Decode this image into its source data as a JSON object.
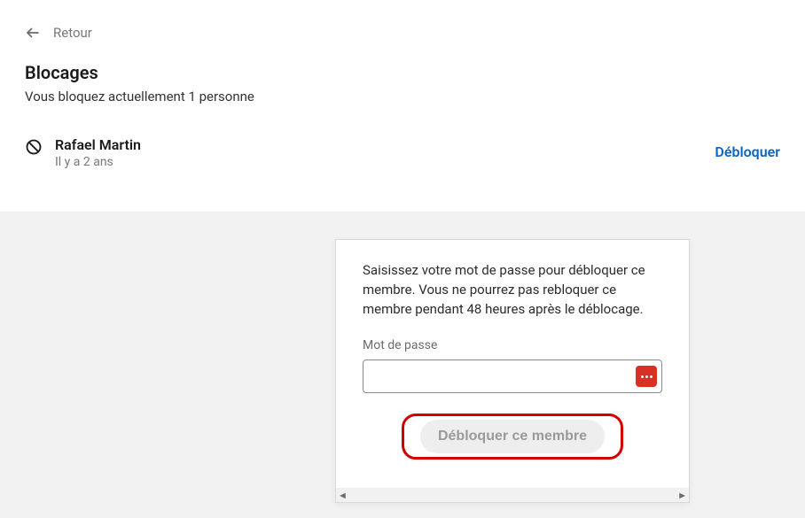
{
  "back": {
    "label": "Retour"
  },
  "header": {
    "title": "Blocages",
    "subtitle": "Vous bloquez actuellement 1 personne"
  },
  "blocked_list": [
    {
      "name": "Rafael Martin",
      "time": "Il y a 2 ans",
      "action_label": "Débloquer"
    }
  ],
  "modal": {
    "instruction": "Saisissez votre mot de passe pour débloquer ce membre. Vous ne pourrez pas rebloquer ce membre pendant 48 heures après le déblocage.",
    "password_label": "Mot de passe",
    "password_value": "",
    "submit_label": "Débloquer ce membre"
  }
}
